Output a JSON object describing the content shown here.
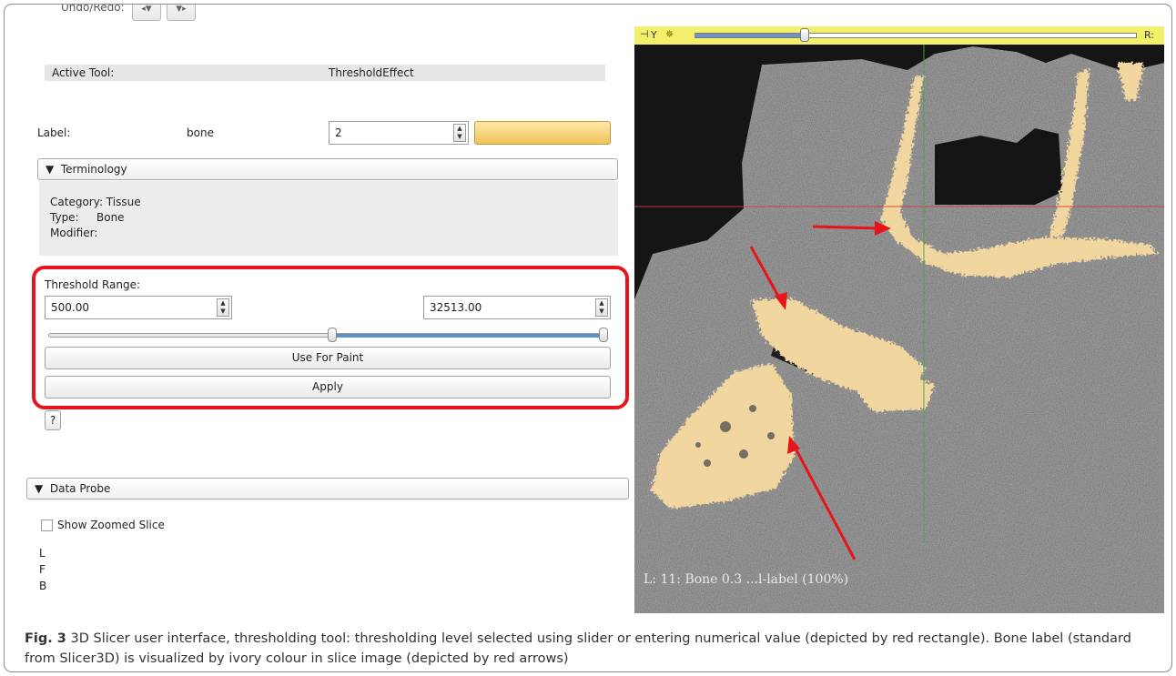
{
  "editor": {
    "undo_redo_label": "Undo/Redo:",
    "active_tool_label": "Active Tool:",
    "active_tool_value": "ThresholdEffect",
    "label_caption": "Label:",
    "label_name": "bone",
    "label_value": "2"
  },
  "terminology": {
    "header": "Terminology",
    "category": "Category: Tissue",
    "type": "Type:",
    "type_value": "Bone",
    "modifier": "Modifier:"
  },
  "threshold": {
    "title": "Threshold Range:",
    "min_value": "500.00",
    "max_value": "32513.00",
    "use_for_paint_label": "Use For Paint",
    "apply_label": "Apply",
    "help_label": "?"
  },
  "data_probe": {
    "header": "Data Probe",
    "show_zoomed_slice": "Show Zoomed Slice",
    "lines": [
      "L",
      "F",
      "B"
    ]
  },
  "viewer": {
    "slice_axis": "Y",
    "right_label": "R:",
    "overlay_text": "L: 11: Bone 0.3   ...l-label (100%)"
  },
  "caption": {
    "fig_label": "Fig. 3",
    "text": " 3D Slicer user interface, thresholding tool: thresholding level selected using slider or entering numerical value (depicted by red rectangle). Bone label (standard from Slicer3D) is visualized by ivory colour in slice image (depicted by red arrows)"
  },
  "colors": {
    "highlight_red": "#e8141c",
    "bone_ivory": "#f2d6a0",
    "viewer_bar": "#f2ef6a"
  }
}
